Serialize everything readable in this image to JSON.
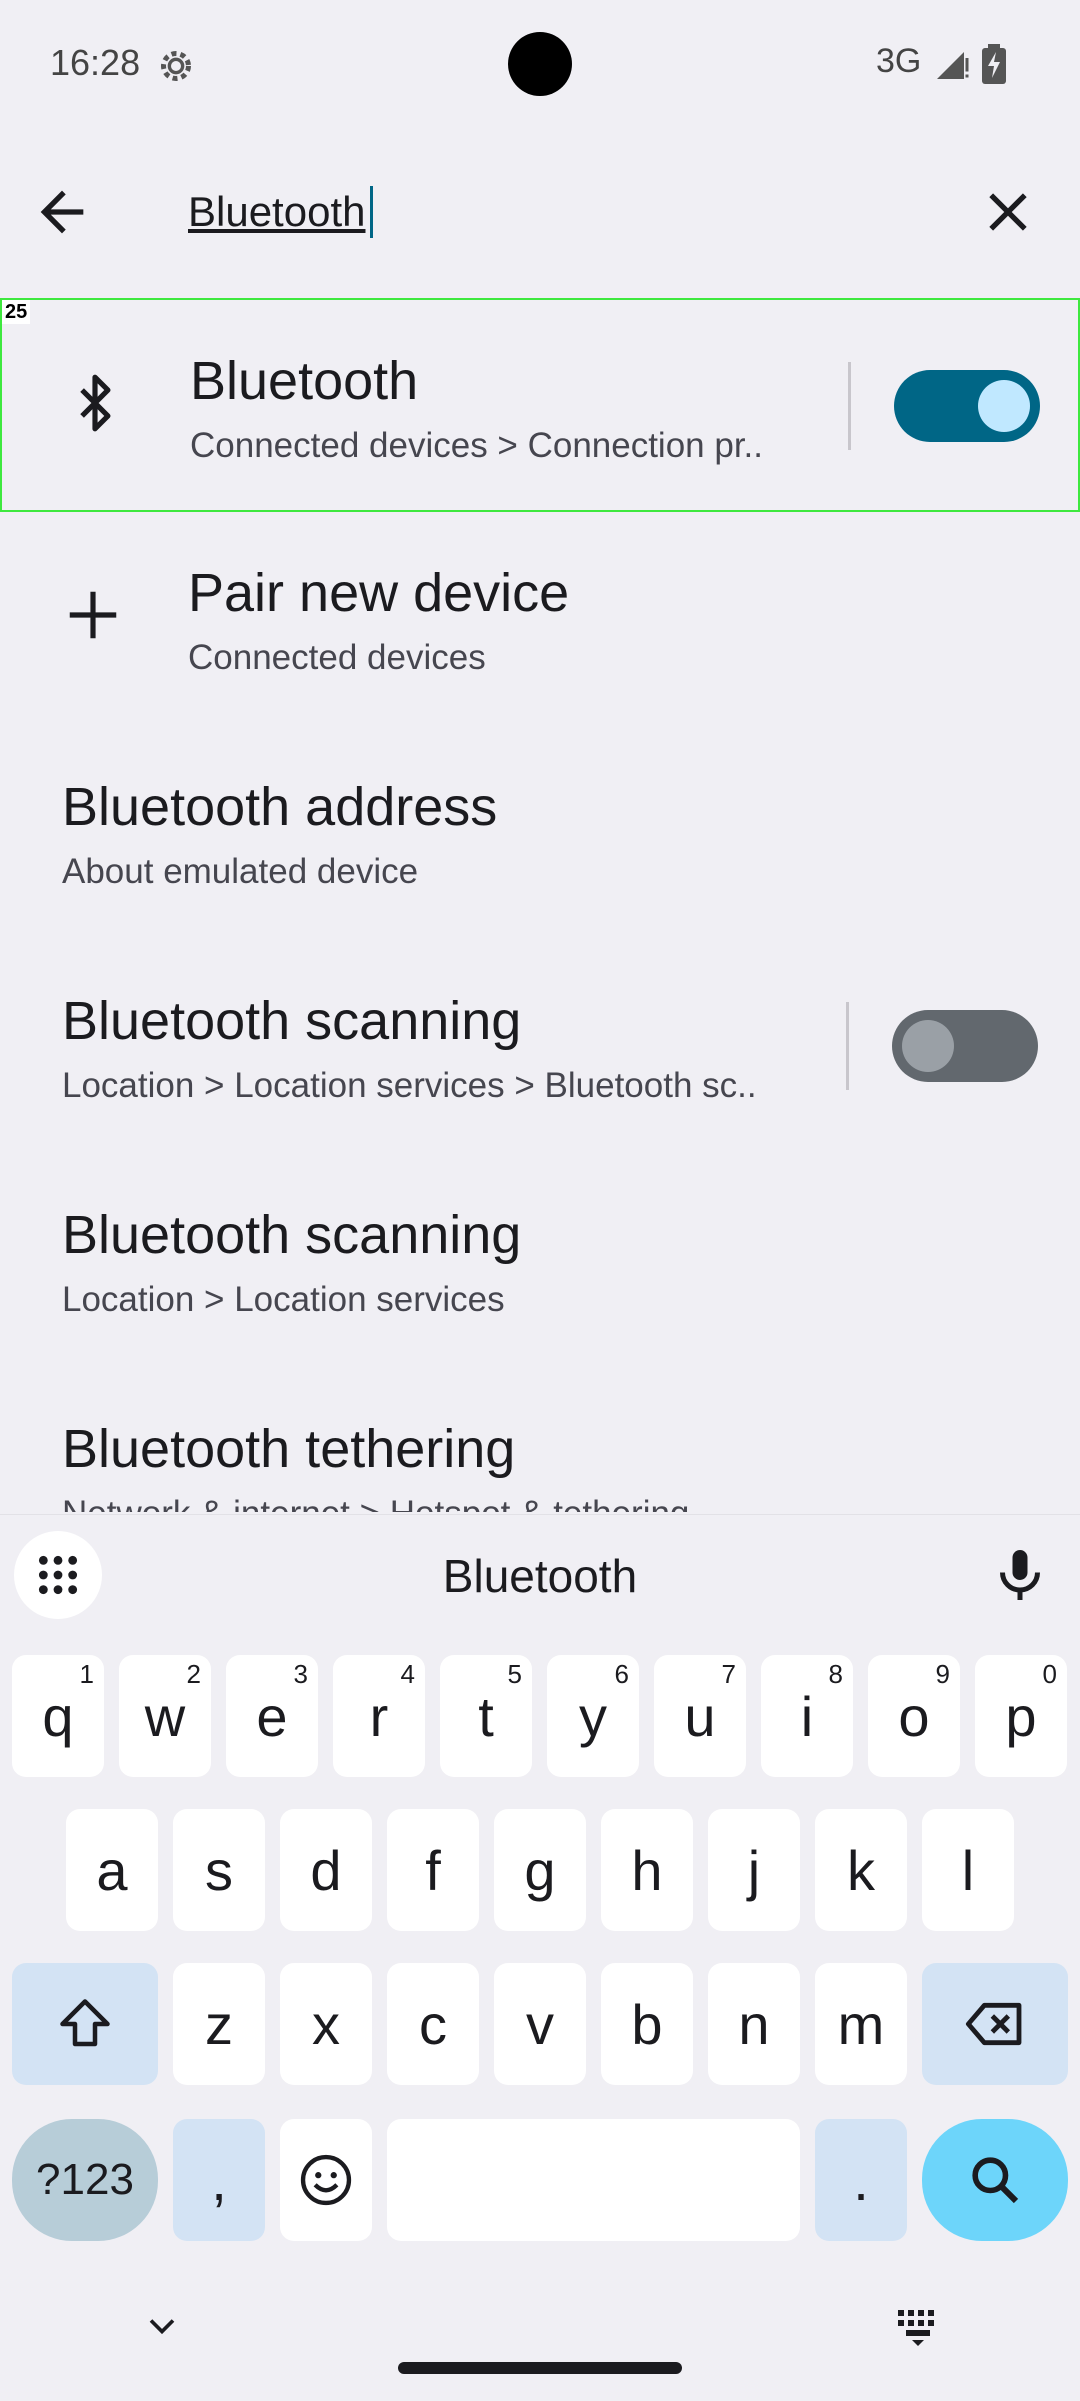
{
  "status_bar": {
    "time": "16:28",
    "network": "3G"
  },
  "search": {
    "query": "Bluetooth"
  },
  "highlight_label": "25",
  "results": [
    {
      "title": "Bluetooth",
      "subtitle": "Connected devices > Connection pr..",
      "toggle": "on"
    },
    {
      "title": "Pair new device",
      "subtitle": "Connected devices"
    },
    {
      "title": "Bluetooth address",
      "subtitle": "About emulated device"
    },
    {
      "title": "Bluetooth scanning",
      "subtitle": "Location > Location services > Bluetooth sc..",
      "toggle": "off"
    },
    {
      "title": "Bluetooth scanning",
      "subtitle": "Location > Location services"
    },
    {
      "title": "Bluetooth tethering",
      "subtitle": "Network & internet > Hotspot & tethering"
    }
  ],
  "keyboard": {
    "suggestion": "Bluetooth",
    "row1": [
      "q",
      "w",
      "e",
      "r",
      "t",
      "y",
      "u",
      "i",
      "o",
      "p"
    ],
    "row1_hints": [
      "1",
      "2",
      "3",
      "4",
      "5",
      "6",
      "7",
      "8",
      "9",
      "0"
    ],
    "row2": [
      "a",
      "s",
      "d",
      "f",
      "g",
      "h",
      "j",
      "k",
      "l"
    ],
    "row3": [
      "z",
      "x",
      "c",
      "v",
      "b",
      "n",
      "m"
    ],
    "symbols_label": "?123",
    "comma": ",",
    "period": ".",
    "accent_color": "#006686",
    "search_key_color": "#6dd5fa"
  }
}
